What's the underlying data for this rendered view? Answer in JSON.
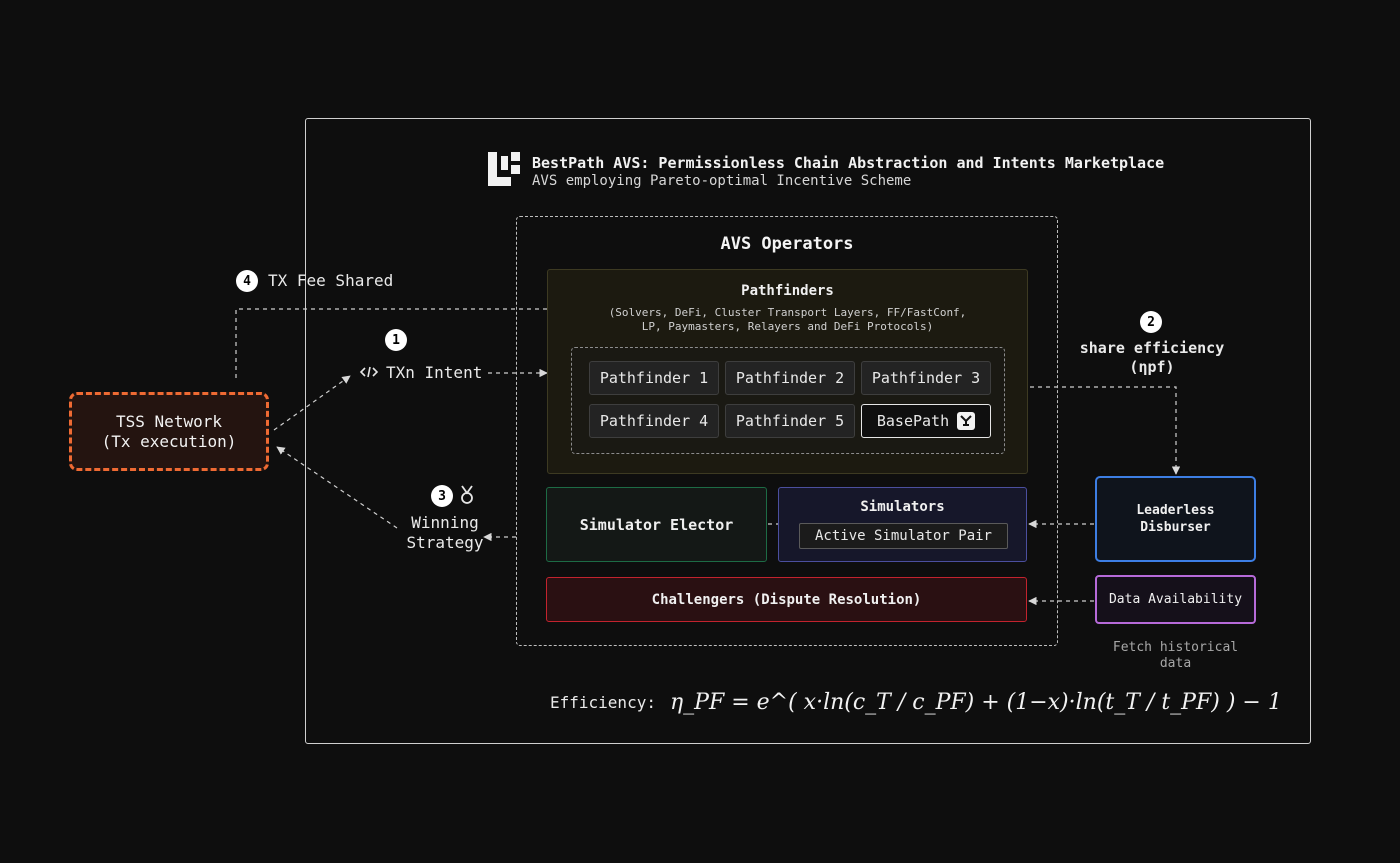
{
  "header": {
    "title": "BestPath AVS: Permissionless Chain Abstraction and Intents Marketplace",
    "subtitle": "AVS employing Pareto-optimal Incentive Scheme"
  },
  "operators": {
    "title": "AVS Operators"
  },
  "pathfinders": {
    "title": "Pathfinders",
    "subtitle_line1": "(Solvers, DeFi, Cluster Transport Layers, FF/FastConf,",
    "subtitle_line2": "LP, Paymasters, Relayers and DeFi Protocols)",
    "items": [
      "Pathfinder 1",
      "Pathfinder 2",
      "Pathfinder 3",
      "Pathfinder 4",
      "Pathfinder 5",
      "BasePath"
    ]
  },
  "simulator_elector": "Simulator Elector",
  "simulators": {
    "title": "Simulators",
    "pair": "Active Simulator Pair"
  },
  "challengers": "Challengers (Dispute Resolution)",
  "tss": {
    "line1": "TSS Network",
    "line2": "(Tx execution)"
  },
  "leaderless": {
    "line1": "Leaderless",
    "line2": "Disburser"
  },
  "data_availability": "Data Availability",
  "fetch_note": {
    "line1": "Fetch historical",
    "line2": "data"
  },
  "steps": {
    "s1": {
      "num": "1",
      "label": "TXn Intent",
      "icon": "code-icon"
    },
    "s2": {
      "num": "2",
      "label1": "share efficiency",
      "label2": "(ηpf)"
    },
    "s3": {
      "num": "3",
      "label1": "Winning",
      "label2": "Strategy",
      "icon": "medal-icon"
    },
    "s4": {
      "num": "4",
      "label": "TX Fee Shared"
    }
  },
  "formula": {
    "label": "Efficiency:",
    "expression": "η_PF = e^( x·ln(c_T / c_PF) + (1−x)·ln(t_T / t_PF) ) − 1"
  },
  "colors": {
    "background": "#0e0e0e",
    "tss_border": "#ee6a33",
    "elector_border": "#1d6b45",
    "simulators_border": "#4b4f9e",
    "challengers_border": "#c3232e",
    "leaderless_border": "#3d7ee3",
    "data_availability_border": "#b66ad8"
  }
}
